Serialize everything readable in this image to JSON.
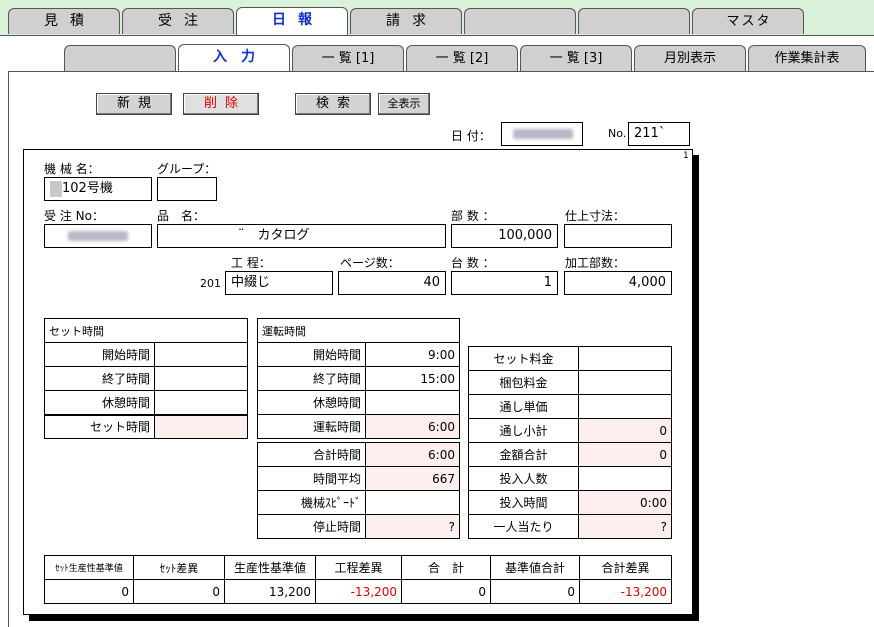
{
  "top_tabs": [
    "見積",
    "受注",
    "日報",
    "請求",
    "",
    "",
    "マスタ"
  ],
  "sub_tabs": [
    "",
    "入力",
    "一 覧 [1]",
    "一 覧 [2]",
    "一 覧 [3]",
    "月別表示",
    "作業集計表"
  ],
  "toolbar": {
    "new": "新規",
    "delete": "削除",
    "search": "検索",
    "show_all": "全表示"
  },
  "header": {
    "date_label": "日 付：",
    "no_label": "No.",
    "no_value": "211`",
    "page_no": "1"
  },
  "form": {
    "machine_label": "機 械 名：",
    "machine_value": "102号機",
    "group_label": "グループ：",
    "group_value": "",
    "order_label": "受 注 No：",
    "product_label": "品　名：",
    "product_value": "¨　カタログ",
    "copies_label": "部 数 ：",
    "copies_value": "100,000",
    "finish_label": "仕上寸法：",
    "finish_value": "",
    "process_label": "工 程：",
    "process_code": "201",
    "process_value": "中綴じ",
    "pages_label": "ページ数：",
    "pages_value": "40",
    "units_label": "台 数 ：",
    "units_value": "1",
    "processed_label": "加工部数：",
    "processed_value": "4,000"
  },
  "setup": {
    "title": "セット時間",
    "rows": [
      {
        "label": "開始時間",
        "value": ""
      },
      {
        "label": "終了時間",
        "value": ""
      },
      {
        "label": "休憩時間",
        "value": ""
      },
      {
        "label": "セット時間",
        "value": ""
      }
    ]
  },
  "running": {
    "title": "運転時間",
    "rows": [
      {
        "label": "開始時間",
        "value": "9:00"
      },
      {
        "label": "終了時間",
        "value": "15:00"
      },
      {
        "label": "休憩時間",
        "value": ""
      },
      {
        "label": "運転時間",
        "value": "6:00"
      }
    ],
    "rows2": [
      {
        "label": "合計時間",
        "value": "6:00"
      },
      {
        "label": "時間平均",
        "value": "667"
      },
      {
        "label": "機械ｽﾋﾟｰﾄﾞ",
        "value": ""
      },
      {
        "label": "停止時間",
        "value": "?"
      }
    ]
  },
  "pricing": {
    "rows": [
      {
        "label": "セット料金",
        "value": ""
      },
      {
        "label": "梱包料金",
        "value": ""
      },
      {
        "label": "通し単価",
        "value": ""
      },
      {
        "label": "通し小計",
        "value": "0"
      },
      {
        "label": "金額合計",
        "value": "0"
      },
      {
        "label": "投入人数",
        "value": ""
      },
      {
        "label": "投入時間",
        "value": "0:00"
      },
      {
        "label": "一人当たり",
        "value": "?"
      }
    ]
  },
  "summary": {
    "headers": [
      "ｾｯﾄ生産性基準値",
      "ｾｯﾄ差異",
      "生産性基準値",
      "工程差異",
      "合　計",
      "基準値合計",
      "合計差異"
    ],
    "values": [
      "0",
      "0",
      "13,200",
      "-13,200",
      "0",
      "0",
      "-13,200"
    ]
  },
  "colors": {
    "accent_blue": "#1030d0",
    "negative_red": "#e00000",
    "tab_band": "#d9f0d9",
    "pink_cell": "#fdeeee"
  }
}
